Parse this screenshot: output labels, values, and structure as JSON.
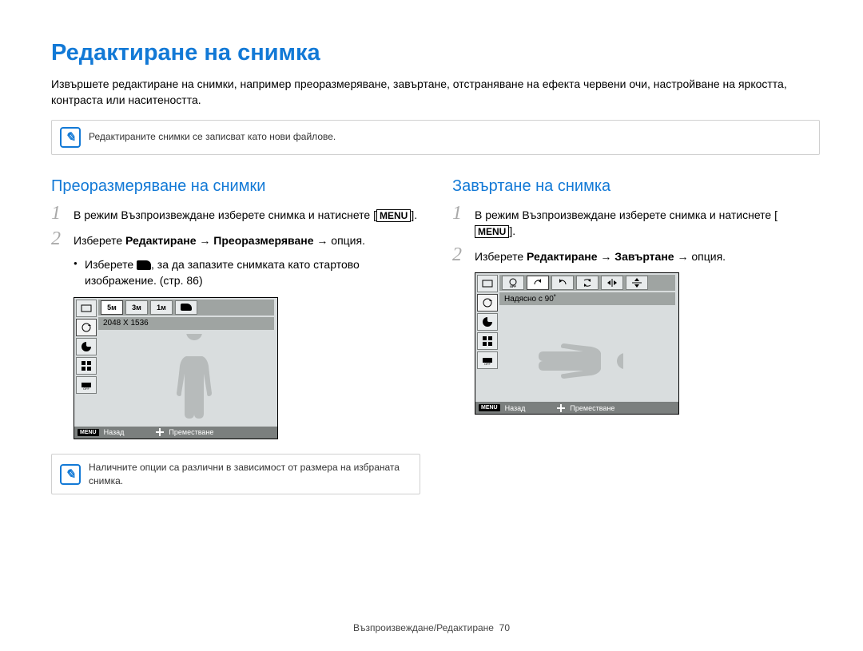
{
  "page_title": "Редактиране на снимка",
  "intro_text": "Извършете редактиране на снимки, например преоразмеряване, завъртане, отстраняване на ефекта червени очи, настройване на яркостта, контраста или наситеността.",
  "note1": "Редактираните снимки се записват като нови файлове.",
  "left": {
    "heading": "Преоразмеряване на снимки",
    "step1_a": "В режим Възпроизвеждане изберете снимка и натиснете [",
    "menu_label": "MENU",
    "step1_b": "].",
    "step2_a": "Изберете ",
    "step2_b": "Редактиране",
    "step2_c": "Преоразмеряване",
    "step2_opt": "опция.",
    "arrow": "→",
    "bullet_a": "Изберете ",
    "bullet_b": ", за да запазите снимката като стартово изображение. (стр. 86)",
    "note2": "Наличните опции са различни в зависимост от размера на избраната снимка.",
    "lcd": {
      "top": [
        "5ᴍ",
        "3ᴍ",
        "1ᴍ"
      ],
      "label": "2048 X 1536",
      "back": "Назад",
      "move": "Преместване",
      "menu_badge": "MENU"
    }
  },
  "right": {
    "heading": "Завъртане на снимка",
    "step1_a": "В режим Възпроизвеждане изберете снимка и натиснете [",
    "menu_label": "MENU",
    "step1_b": "].",
    "step2_a": "Изберете ",
    "step2_b": "Редактиране",
    "step2_c": "Завъртане",
    "step2_opt": "опция.",
    "arrow": "→",
    "lcd": {
      "label": "Надясно с 90˚",
      "back": "Назад",
      "move": "Преместване",
      "menu_badge": "MENU"
    }
  },
  "footer_section": "Възпроизвеждане/Редактиране",
  "footer_page": "70"
}
